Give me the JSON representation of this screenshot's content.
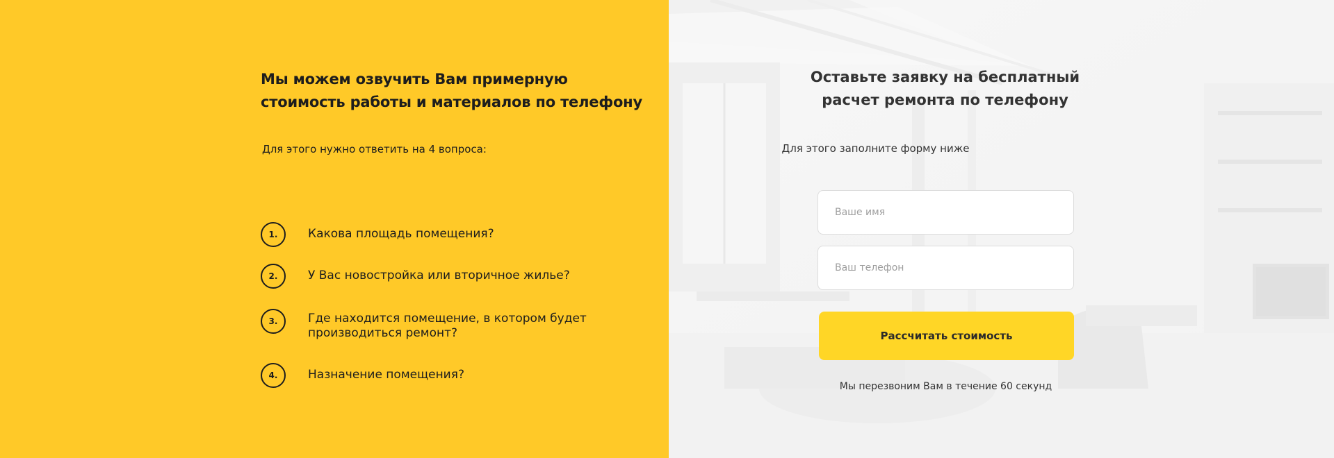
{
  "left": {
    "heading": "Мы можем озвучить Вам примерную стоимость работы и материалов по телефону",
    "subheading": "Для этого нужно ответить на 4 вопроса:",
    "questions": [
      {
        "num": "1.",
        "text": "Какова площадь помещения?"
      },
      {
        "num": "2.",
        "text": "У Вас новостройка или вторичное жилье?"
      },
      {
        "num": "3.",
        "text": "Где находится помещение, в котором будет производиться ремонт?"
      },
      {
        "num": "4.",
        "text": "Назначение помещения?"
      }
    ]
  },
  "right": {
    "heading": "Оставьте заявку на бесплатный расчет ремонта по телефону",
    "subheading": "Для этого заполните форму ниже",
    "name_placeholder": "Ваше имя",
    "phone_placeholder": "Ваш телефон",
    "submit_label": "Рассчитать стоимость",
    "callback_note": "Мы перезвоним Вам в течение 60 секунд"
  },
  "colors": {
    "left_bg": "#FFC928",
    "button_bg": "#FFD626",
    "text_dark": "#1d1d1d"
  }
}
